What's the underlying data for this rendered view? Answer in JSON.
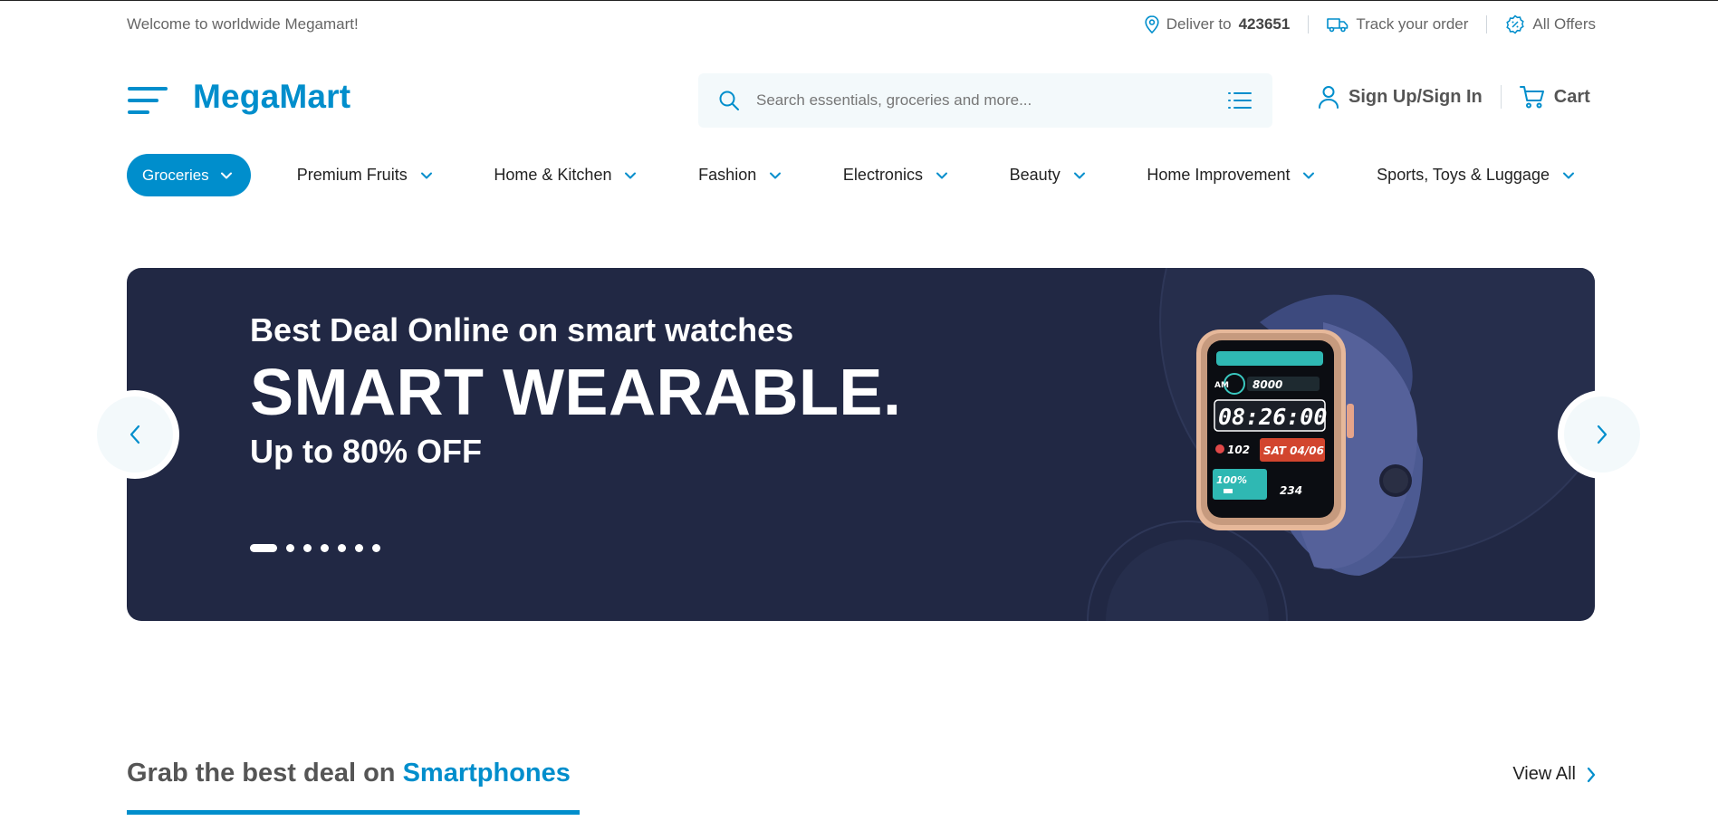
{
  "topbar": {
    "welcome": "Welcome to worldwide Megamart!",
    "deliver_prefix": "Deliver to",
    "pincode": "423651",
    "track": "Track your order",
    "offers": "All Offers"
  },
  "header": {
    "logo": "MegaMart",
    "search_placeholder": "Search essentials, groceries and more...",
    "signin": "Sign Up/Sign In",
    "cart": "Cart"
  },
  "nav": {
    "active": "Groceries",
    "items": [
      "Premium Fruits",
      "Home & Kitchen",
      "Fashion",
      "Electronics",
      "Beauty",
      "Home Improvement",
      "Sports, Toys & Luggage"
    ]
  },
  "hero": {
    "subtitle": "Best Deal Online on smart watches",
    "title": "SMART WEARABLE.",
    "offer": "Up to 80% OFF",
    "slide_count": 7,
    "active_slide": 1,
    "watch": {
      "time": "08:26:00",
      "steps": "8000",
      "heart": "102",
      "date": "SAT 04/06",
      "battery": "100%",
      "cal": "234",
      "am": "AM"
    }
  },
  "section": {
    "title_prefix": "Grab the best deal on",
    "title_highlight": "Smartphones",
    "view_all": "View All"
  },
  "colors": {
    "accent": "#008ECC",
    "hero_bg": "#212844",
    "search_bg": "#F3F9FB"
  },
  "icons": [
    "location-pin-icon",
    "truck-icon",
    "offer-badge-icon",
    "hamburger-menu-icon",
    "search-icon",
    "filter-list-icon",
    "user-icon",
    "cart-icon",
    "chevron-down-icon",
    "chevron-left-icon",
    "chevron-right-icon"
  ]
}
